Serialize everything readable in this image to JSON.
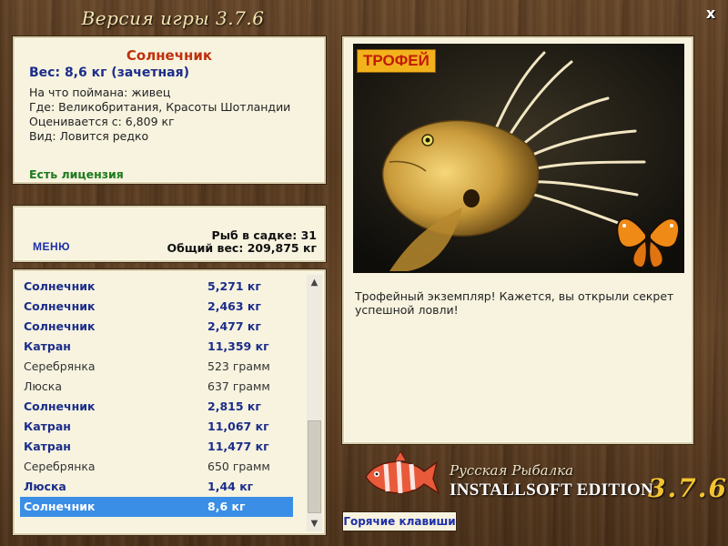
{
  "window": {
    "title": "Версия игры 3.7.6",
    "close_label": "x"
  },
  "fish_info": {
    "name": "Солнечник",
    "weight": "Вес: 8,6 кг (зачетная)",
    "lines": [
      "На что поймана: живец",
      "Где: Великобритания, Красоты Шотландии",
      "Оценивается с: 6,809 кг",
      "Вид: Ловится редко"
    ],
    "license": "Есть лицензия"
  },
  "summary": {
    "menu": "МЕНЮ",
    "fish_in_cage": "Рыб в садке: 31",
    "total_weight": "Общий вес: 209,875 кг"
  },
  "catch_list": [
    {
      "name": "Солнечник",
      "weight": "5,271 кг",
      "style": "bold"
    },
    {
      "name": "Солнечник",
      "weight": "2,463 кг",
      "style": "bold"
    },
    {
      "name": "Солнечник",
      "weight": "2,477 кг",
      "style": "bold"
    },
    {
      "name": "Катран",
      "weight": "11,359 кг",
      "style": "bold"
    },
    {
      "name": "Серебрянка",
      "weight": "523 грамм",
      "style": "plain"
    },
    {
      "name": "Люска",
      "weight": "637 грамм",
      "style": "plain"
    },
    {
      "name": "Солнечник",
      "weight": "2,815 кг",
      "style": "bold"
    },
    {
      "name": "Катран",
      "weight": "11,067 кг",
      "style": "bold"
    },
    {
      "name": "Катран",
      "weight": "11,477 кг",
      "style": "bold"
    },
    {
      "name": "Серебрянка",
      "weight": "650 грамм",
      "style": "plain"
    },
    {
      "name": "Люска",
      "weight": "1,44 кг",
      "style": "bold"
    },
    {
      "name": "Солнечник",
      "weight": "8,6 кг",
      "style": "selected"
    }
  ],
  "trophy": {
    "badge": "ТРОФЕЙ",
    "text": "Трофейный экземпляр! Кажется, вы открыли секрет успешной ловли!"
  },
  "brand": {
    "subtitle": "Русская Рыбалка",
    "main": "INSTALLSOFT EDITION",
    "version": "3.7.6"
  },
  "hotkeys": "Горячие клавиши",
  "colors": {
    "fish_name": "#c0300c",
    "weight_blue": "#1c2d8a",
    "license_green": "#1d7a1d",
    "selection": "#3a8ee6",
    "trophy_badge_bg": "#f2b21c"
  }
}
